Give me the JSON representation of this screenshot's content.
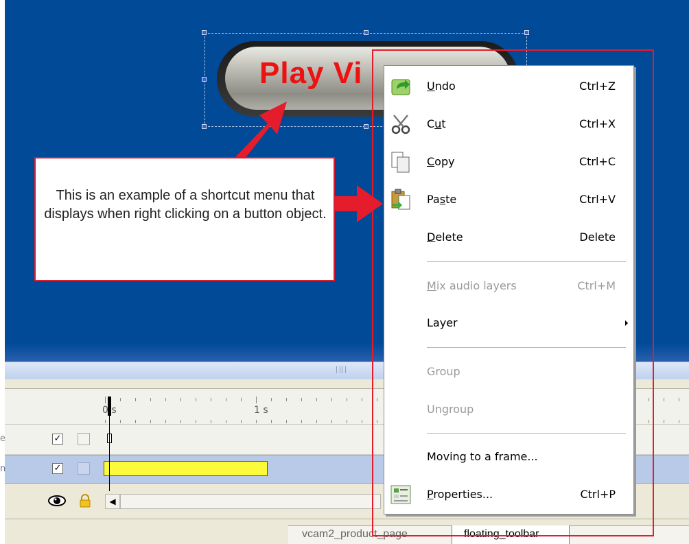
{
  "colors": {
    "canvas_bg": "#004a98",
    "highlight_red": "#e41c2c",
    "button_text_red": "#ee1111",
    "timeline_bar_yellow": "#fbfb3c"
  },
  "canvas": {
    "button_text": "Play Vi"
  },
  "callout": {
    "text": "This is an example of a shortcut menu that displays when right clicking on a button object."
  },
  "timeline": {
    "ruler_labels": [
      "0 s",
      "1 s"
    ],
    "row1_stub": "e",
    "row2_stub": "n",
    "check_mark": "✓",
    "eye_icon": "eye-icon",
    "lock_icon": "lock-icon"
  },
  "tabs": [
    {
      "label": "vcam2_product_page",
      "active": false
    },
    {
      "label": "floating_toolbar",
      "active": true
    }
  ],
  "context_menu": {
    "items": [
      {
        "label_pre": "",
        "label_key": "U",
        "label_post": "ndo",
        "shortcut": "Ctrl+Z",
        "icon": "undo-icon",
        "enabled": true
      },
      {
        "label_pre": "C",
        "label_key": "u",
        "label_post": "t",
        "shortcut": "Ctrl+X",
        "icon": "scissors-icon",
        "enabled": true
      },
      {
        "label_pre": "",
        "label_key": "C",
        "label_post": "opy",
        "shortcut": "Ctrl+C",
        "icon": "copy-icon",
        "enabled": true
      },
      {
        "label_pre": "Pa",
        "label_key": "s",
        "label_post": "te",
        "shortcut": "Ctrl+V",
        "icon": "paste-icon",
        "enabled": true
      },
      {
        "label_pre": "",
        "label_key": "D",
        "label_post": "elete",
        "shortcut": "Delete",
        "icon": "",
        "enabled": true
      },
      {
        "label_pre": "",
        "label_key": "M",
        "label_post": "ix audio layers",
        "shortcut": "Ctrl+M",
        "icon": "",
        "enabled": false
      },
      {
        "label_pre": "",
        "label_key": "",
        "label_post": "Layer",
        "shortcut": "",
        "icon": "",
        "enabled": true,
        "submenu": true
      },
      {
        "label_pre": "",
        "label_key": "",
        "label_post": "Group",
        "shortcut": "",
        "icon": "",
        "enabled": false
      },
      {
        "label_pre": "",
        "label_key": "",
        "label_post": "Ungroup",
        "shortcut": "",
        "icon": "",
        "enabled": false
      },
      {
        "label_pre": "",
        "label_key": "",
        "label_post": "Moving to a frame...",
        "shortcut": "",
        "icon": "",
        "enabled": true
      },
      {
        "label_pre": "",
        "label_key": "P",
        "label_post": "roperties...",
        "shortcut": "Ctrl+P",
        "icon": "properties-icon",
        "enabled": true
      }
    ]
  }
}
